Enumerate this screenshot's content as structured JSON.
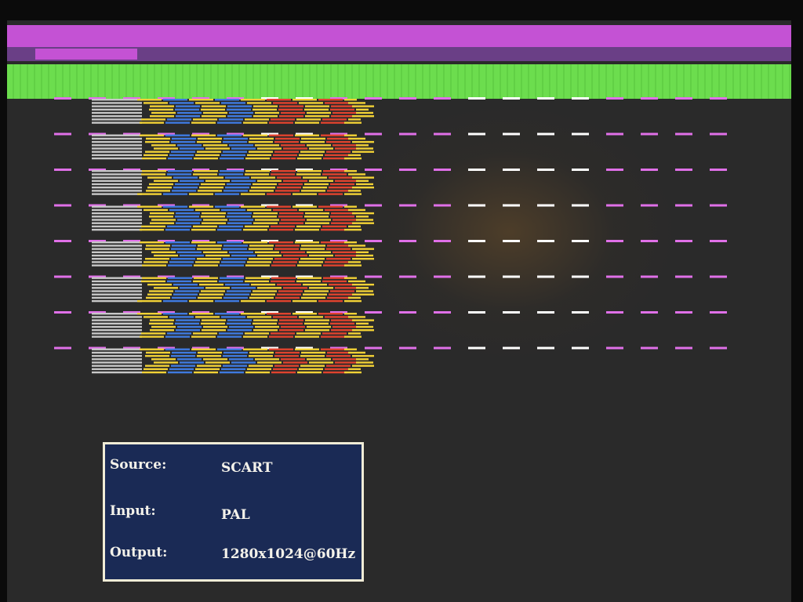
{
  "colors": {
    "screen_bg": "#2a2a2a",
    "top_bar_magenta": "#c452d4",
    "top_bar_purple": "#6a3f86",
    "top_bar_green": "#6cdd4e",
    "dash_magenta": "#e070e8",
    "dash_white": "#ffffff",
    "stripe_gray": "#c8c8c8",
    "stripe_yellow": "#f2d236",
    "stripe_blue": "#3f7ae0",
    "stripe_red": "#e0432e",
    "osd_background": "#1a2a55",
    "osd_border": "#f0ecd6"
  },
  "osd": {
    "source_label": "Source:",
    "source_value": "SCART",
    "input_label": "Input:",
    "input_value": "PAL",
    "output_label": "Output:",
    "output_value": "1280x1024@60Hz"
  }
}
